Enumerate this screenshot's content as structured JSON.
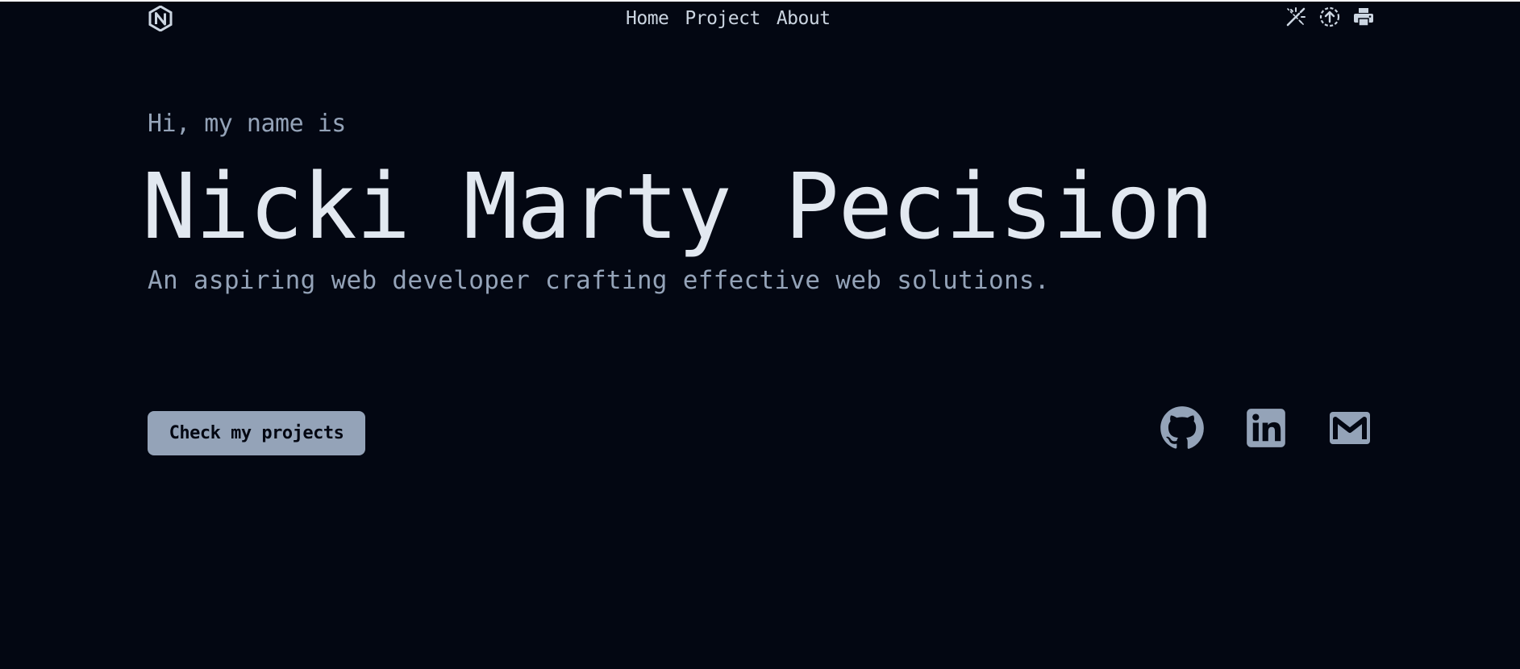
{
  "colors": {
    "background": "#030712",
    "text_primary": "#e2e8f0",
    "text_secondary": "#94a3b8",
    "nav_text": "#cbd5e1",
    "button_bg": "#94a3b8",
    "button_text": "#030712"
  },
  "header": {
    "logo_icon": "n-hexagon-logo",
    "nav": [
      {
        "label": "Home"
      },
      {
        "label": "Project"
      },
      {
        "label": "About"
      }
    ],
    "tools": [
      {
        "icon": "theme-toggle-icon"
      },
      {
        "icon": "scroll-up-icon"
      },
      {
        "icon": "print-icon"
      }
    ]
  },
  "hero": {
    "greeting": "Hi, my name is",
    "name": "Nicki Marty Pecision",
    "tagline": "An aspiring web developer crafting effective web solutions.",
    "cta_label": "Check my projects"
  },
  "social": [
    {
      "icon": "github-icon"
    },
    {
      "icon": "linkedin-icon"
    },
    {
      "icon": "gmail-icon"
    }
  ]
}
